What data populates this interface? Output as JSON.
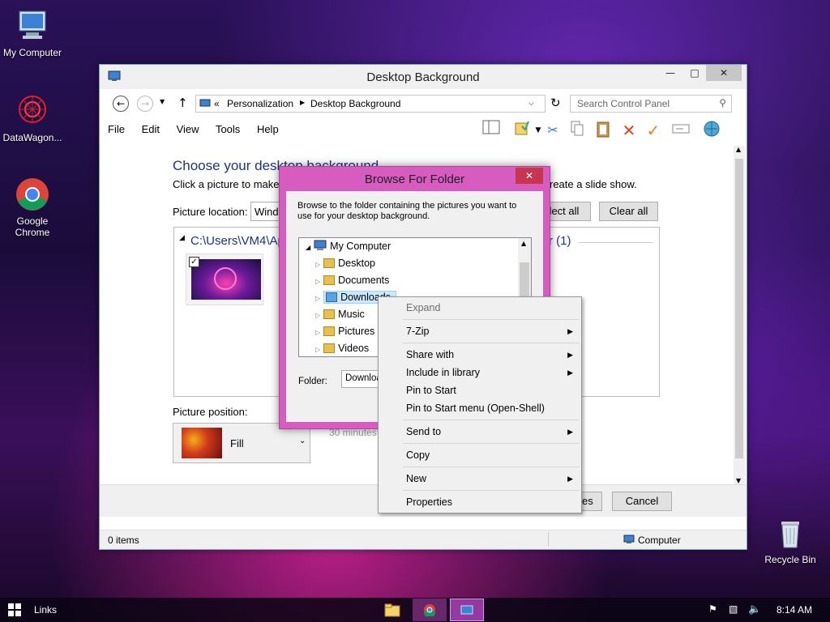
{
  "desktop": {
    "icons": [
      {
        "label": "My Computer"
      },
      {
        "label": "DataWagon..."
      },
      {
        "label": "Google Chrome"
      },
      {
        "label": "Recycle Bin"
      }
    ]
  },
  "window": {
    "title": "Desktop Background",
    "breadcrumb": {
      "prefix": "«",
      "items": [
        "Personalization",
        "Desktop Background"
      ]
    },
    "search_placeholder": "Search Control Panel",
    "menu": [
      "File",
      "Edit",
      "View",
      "Tools",
      "Help"
    ],
    "heading": "Choose your desktop background",
    "instructions_left": "Click a picture to make it",
    "instructions_right": "reate a slide show.",
    "picture_location_label": "Picture location:",
    "picture_location_value": "Windo",
    "select_all": "lect all",
    "clear_all": "Clear all",
    "folder_path": "C:\\Users\\VM4\\Ap",
    "group_count": "r (1)",
    "picture_position_label": "Picture position:",
    "picture_position_value": "Fill",
    "interval_value": "30 minutes",
    "save_button": "es",
    "cancel_button": "Cancel",
    "status_items": "0 items",
    "status_location": "Computer"
  },
  "browse_dialog": {
    "title": "Browse For Folder",
    "description": "Browse to the folder containing the pictures you want to use for your desktop background.",
    "tree": [
      {
        "label": "My Computer",
        "level": 0,
        "expanded": true
      },
      {
        "label": "Desktop",
        "level": 1
      },
      {
        "label": "Documents",
        "level": 1
      },
      {
        "label": "Downloads",
        "level": 1,
        "selected": true
      },
      {
        "label": "Music",
        "level": 1
      },
      {
        "label": "Pictures",
        "level": 1
      },
      {
        "label": "Videos",
        "level": 1
      }
    ],
    "folder_label": "Folder:",
    "folder_value": "Downloa"
  },
  "context_menu": {
    "items": [
      {
        "label": "Expand",
        "disabled": true
      },
      {
        "label": "7-Zip",
        "submenu": true
      },
      {
        "label": "Share with",
        "submenu": true
      },
      {
        "label": "Include in library",
        "submenu": true
      },
      {
        "label": "Pin to Start"
      },
      {
        "label": "Pin to Start menu (Open-Shell)"
      },
      {
        "label": "Send to",
        "submenu": true
      },
      {
        "label": "Copy"
      },
      {
        "label": "New",
        "submenu": true
      },
      {
        "label": "Properties"
      }
    ]
  },
  "taskbar": {
    "links_label": "Links",
    "clock": "8:14 AM"
  },
  "colors": {
    "dialog_frame": "#d85bc0",
    "heading": "#1e3287",
    "close_button": "#c7364f"
  }
}
